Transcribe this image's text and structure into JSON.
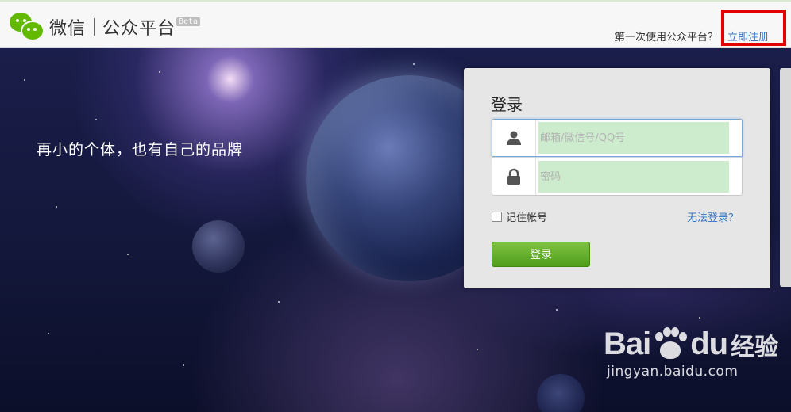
{
  "header": {
    "brand": "微信",
    "platform": "公众平台",
    "beta_badge": "Beta",
    "first_time_hint": "第一次使用公众平台？",
    "register_link": "立即注册"
  },
  "hero": {
    "slogan": "再小的个体，也有自己的品牌"
  },
  "login": {
    "title": "登录",
    "username_placeholder": "邮箱/微信号/QQ号",
    "password_placeholder": "密码",
    "remember_label": "记住帐号",
    "cant_login_link": "无法登录？",
    "submit_label": "登录"
  },
  "icons": {
    "user_field": "user-icon",
    "password_field": "lock-icon",
    "logo": "wechat-logo"
  },
  "colors": {
    "accent_green": "#62b900",
    "link_blue": "#3271bf",
    "highlight_red": "#e30000",
    "button_green": "#5aa821"
  },
  "watermark": {
    "brand_left": "Bai",
    "brand_right": "du",
    "brand_cn": "经验",
    "url": "jingyan.baidu.com"
  }
}
